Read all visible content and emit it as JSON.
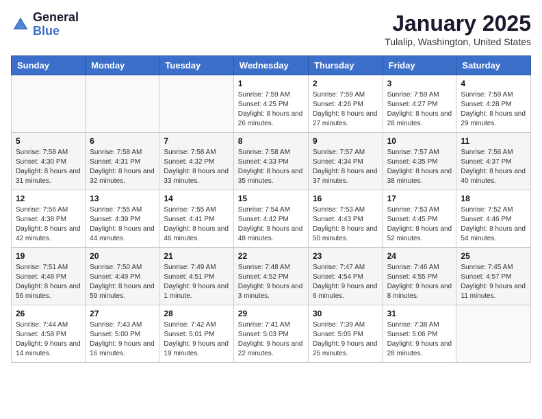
{
  "header": {
    "logo_general": "General",
    "logo_blue": "Blue",
    "month_title": "January 2025",
    "location": "Tulalip, Washington, United States"
  },
  "weekdays": [
    "Sunday",
    "Monday",
    "Tuesday",
    "Wednesday",
    "Thursday",
    "Friday",
    "Saturday"
  ],
  "weeks": [
    [
      {
        "day": "",
        "info": ""
      },
      {
        "day": "",
        "info": ""
      },
      {
        "day": "",
        "info": ""
      },
      {
        "day": "1",
        "info": "Sunrise: 7:59 AM\nSunset: 4:25 PM\nDaylight: 8 hours and 26 minutes."
      },
      {
        "day": "2",
        "info": "Sunrise: 7:59 AM\nSunset: 4:26 PM\nDaylight: 8 hours and 27 minutes."
      },
      {
        "day": "3",
        "info": "Sunrise: 7:59 AM\nSunset: 4:27 PM\nDaylight: 8 hours and 28 minutes."
      },
      {
        "day": "4",
        "info": "Sunrise: 7:59 AM\nSunset: 4:28 PM\nDaylight: 8 hours and 29 minutes."
      }
    ],
    [
      {
        "day": "5",
        "info": "Sunrise: 7:58 AM\nSunset: 4:30 PM\nDaylight: 8 hours and 31 minutes."
      },
      {
        "day": "6",
        "info": "Sunrise: 7:58 AM\nSunset: 4:31 PM\nDaylight: 8 hours and 32 minutes."
      },
      {
        "day": "7",
        "info": "Sunrise: 7:58 AM\nSunset: 4:32 PM\nDaylight: 8 hours and 33 minutes."
      },
      {
        "day": "8",
        "info": "Sunrise: 7:58 AM\nSunset: 4:33 PM\nDaylight: 8 hours and 35 minutes."
      },
      {
        "day": "9",
        "info": "Sunrise: 7:57 AM\nSunset: 4:34 PM\nDaylight: 8 hours and 37 minutes."
      },
      {
        "day": "10",
        "info": "Sunrise: 7:57 AM\nSunset: 4:35 PM\nDaylight: 8 hours and 38 minutes."
      },
      {
        "day": "11",
        "info": "Sunrise: 7:56 AM\nSunset: 4:37 PM\nDaylight: 8 hours and 40 minutes."
      }
    ],
    [
      {
        "day": "12",
        "info": "Sunrise: 7:56 AM\nSunset: 4:38 PM\nDaylight: 8 hours and 42 minutes."
      },
      {
        "day": "13",
        "info": "Sunrise: 7:55 AM\nSunset: 4:39 PM\nDaylight: 8 hours and 44 minutes."
      },
      {
        "day": "14",
        "info": "Sunrise: 7:55 AM\nSunset: 4:41 PM\nDaylight: 8 hours and 46 minutes."
      },
      {
        "day": "15",
        "info": "Sunrise: 7:54 AM\nSunset: 4:42 PM\nDaylight: 8 hours and 48 minutes."
      },
      {
        "day": "16",
        "info": "Sunrise: 7:53 AM\nSunset: 4:43 PM\nDaylight: 8 hours and 50 minutes."
      },
      {
        "day": "17",
        "info": "Sunrise: 7:53 AM\nSunset: 4:45 PM\nDaylight: 8 hours and 52 minutes."
      },
      {
        "day": "18",
        "info": "Sunrise: 7:52 AM\nSunset: 4:46 PM\nDaylight: 8 hours and 54 minutes."
      }
    ],
    [
      {
        "day": "19",
        "info": "Sunrise: 7:51 AM\nSunset: 4:48 PM\nDaylight: 8 hours and 56 minutes."
      },
      {
        "day": "20",
        "info": "Sunrise: 7:50 AM\nSunset: 4:49 PM\nDaylight: 8 hours and 59 minutes."
      },
      {
        "day": "21",
        "info": "Sunrise: 7:49 AM\nSunset: 4:51 PM\nDaylight: 9 hours and 1 minute."
      },
      {
        "day": "22",
        "info": "Sunrise: 7:48 AM\nSunset: 4:52 PM\nDaylight: 9 hours and 3 minutes."
      },
      {
        "day": "23",
        "info": "Sunrise: 7:47 AM\nSunset: 4:54 PM\nDaylight: 9 hours and 6 minutes."
      },
      {
        "day": "24",
        "info": "Sunrise: 7:46 AM\nSunset: 4:55 PM\nDaylight: 9 hours and 8 minutes."
      },
      {
        "day": "25",
        "info": "Sunrise: 7:45 AM\nSunset: 4:57 PM\nDaylight: 9 hours and 11 minutes."
      }
    ],
    [
      {
        "day": "26",
        "info": "Sunrise: 7:44 AM\nSunset: 4:58 PM\nDaylight: 9 hours and 14 minutes."
      },
      {
        "day": "27",
        "info": "Sunrise: 7:43 AM\nSunset: 5:00 PM\nDaylight: 9 hours and 16 minutes."
      },
      {
        "day": "28",
        "info": "Sunrise: 7:42 AM\nSunset: 5:01 PM\nDaylight: 9 hours and 19 minutes."
      },
      {
        "day": "29",
        "info": "Sunrise: 7:41 AM\nSunset: 5:03 PM\nDaylight: 9 hours and 22 minutes."
      },
      {
        "day": "30",
        "info": "Sunrise: 7:39 AM\nSunset: 5:05 PM\nDaylight: 9 hours and 25 minutes."
      },
      {
        "day": "31",
        "info": "Sunrise: 7:38 AM\nSunset: 5:06 PM\nDaylight: 9 hours and 28 minutes."
      },
      {
        "day": "",
        "info": ""
      }
    ]
  ]
}
